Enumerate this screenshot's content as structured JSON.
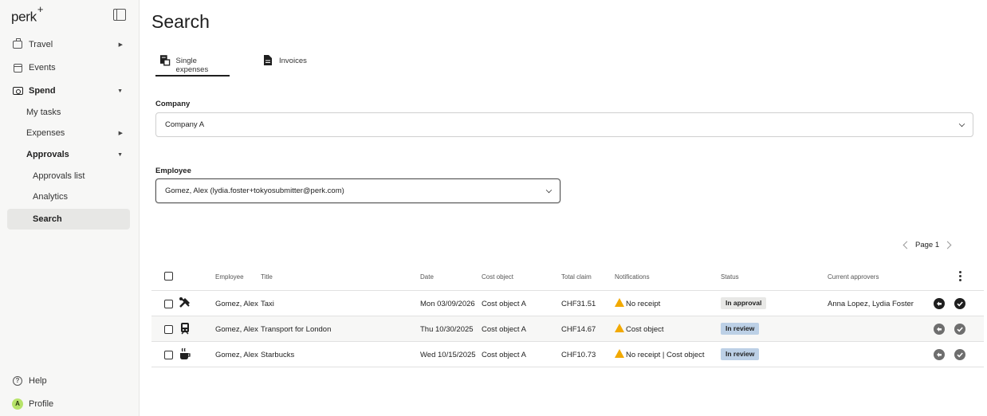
{
  "sidebar": {
    "logo": "perk",
    "logo_sup": "+",
    "items": [
      {
        "label": "Travel",
        "icon": "briefcase-icon"
      },
      {
        "label": "Events",
        "icon": "calendar-icon"
      },
      {
        "label": "Spend",
        "icon": "money-icon"
      },
      {
        "label": "My tasks"
      },
      {
        "label": "Expenses"
      },
      {
        "label": "Approvals"
      },
      {
        "label": "Approvals list"
      },
      {
        "label": "Analytics"
      },
      {
        "label": "Search"
      }
    ],
    "help": "Help",
    "profile": "Profile",
    "avatar_initial": "A"
  },
  "page": {
    "title": "Search"
  },
  "tabs": [
    {
      "label": "Single expenses",
      "icon": "receipt-icon"
    },
    {
      "label": "Invoices",
      "icon": "document-icon"
    }
  ],
  "filters": {
    "company_label": "Company",
    "company_value": "Company A",
    "employee_label": "Employee",
    "employee_value": "Gomez, Alex (lydia.foster+tokyosubmitter@perk.com)"
  },
  "pager": {
    "label": "Page 1"
  },
  "table": {
    "headers": [
      "Employee",
      "Title",
      "Date",
      "Cost object",
      "Total claim",
      "Notifications",
      "Status",
      "Current approvers"
    ],
    "rows": [
      {
        "employee": "Gomez, Alex",
        "title": "Taxi",
        "date": "Mon 03/09/2026",
        "cost_object": "Cost object A",
        "total": "CHF31.51",
        "notification": "No receipt",
        "status": "In approval",
        "approvers": "Anna Lopez, Lydia Foster",
        "icon": "tools-icon"
      },
      {
        "employee": "Gomez, Alex",
        "title": "Transport for London",
        "date": "Thu 10/30/2025",
        "cost_object": "Cost object A",
        "total": "CHF14.67",
        "notification": "Cost object",
        "status": "In review",
        "approvers": "",
        "icon": "train-icon"
      },
      {
        "employee": "Gomez, Alex",
        "title": "Starbucks",
        "date": "Wed 10/15/2025",
        "cost_object": "Cost object A",
        "total": "CHF10.73",
        "notification": "No receipt | Cost object",
        "status": "In review",
        "approvers": "",
        "icon": "coffee-icon"
      }
    ]
  },
  "colors": {
    "status_in_approval": "#e8e8e6",
    "status_in_review": "#bcd0e6",
    "warning": "#f2a900"
  }
}
